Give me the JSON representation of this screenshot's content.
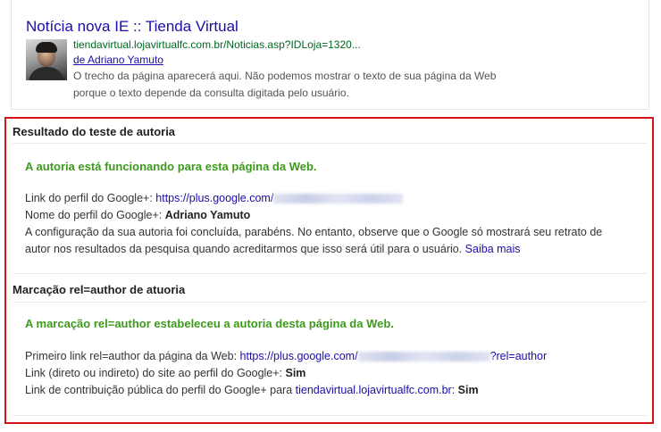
{
  "preview": {
    "title": "Notícia nova IE :: Tienda Virtual",
    "url": "tiendavirtual.lojavirtualfc.com.br/Noticias.asp?IDLoja=1320...",
    "byline": "de Adriano Yamuto",
    "snippet": "O trecho da página aparecerá aqui. Não podemos mostrar o texto de sua página da Web porque o texto depende da consulta digitada pelo usuário."
  },
  "authorship": {
    "header": "Resultado do teste de autoria",
    "success": "A autoria está funcionando para esta página da Web.",
    "profile_link_label": "Link do perfil do Google+: ",
    "profile_link_url": "https://plus.google.com/",
    "profile_name_label": "Nome do perfil do Google+: ",
    "profile_name": "Adriano Yamuto",
    "note_line1": "A configuração da sua autoria foi concluída, parabéns. No entanto, observe que o Google só mostrará seu retrato de",
    "note_line2": "autor nos resultados da pesquisa quando acreditarmos que isso será útil para o usuário.",
    "learn_more": "Saiba mais"
  },
  "markup": {
    "header": "Marcação rel=author de atuoria",
    "success": "A marcação rel=author estabeleceu a autoria desta página da Web.",
    "first_link_label": "Primeiro link rel=author da página da Web: ",
    "first_link_url_start": "https://plus.google.com/",
    "first_link_url_end": "?rel=author",
    "site_link_label": "Link (direto ou indireto) do site ao perfil do Google+: ",
    "site_link_value": "Sim",
    "contrib_label": "Link de contribuição pública do perfil do Google+ para ",
    "contrib_link": "tiendavirtual.lojavirtualfc.com.br",
    "contrib_value": "Sim"
  },
  "colors": {
    "link": "#1a0dab",
    "url_green": "#006621",
    "success_green": "#3d9a1b",
    "highlight_border": "#d7141a"
  }
}
